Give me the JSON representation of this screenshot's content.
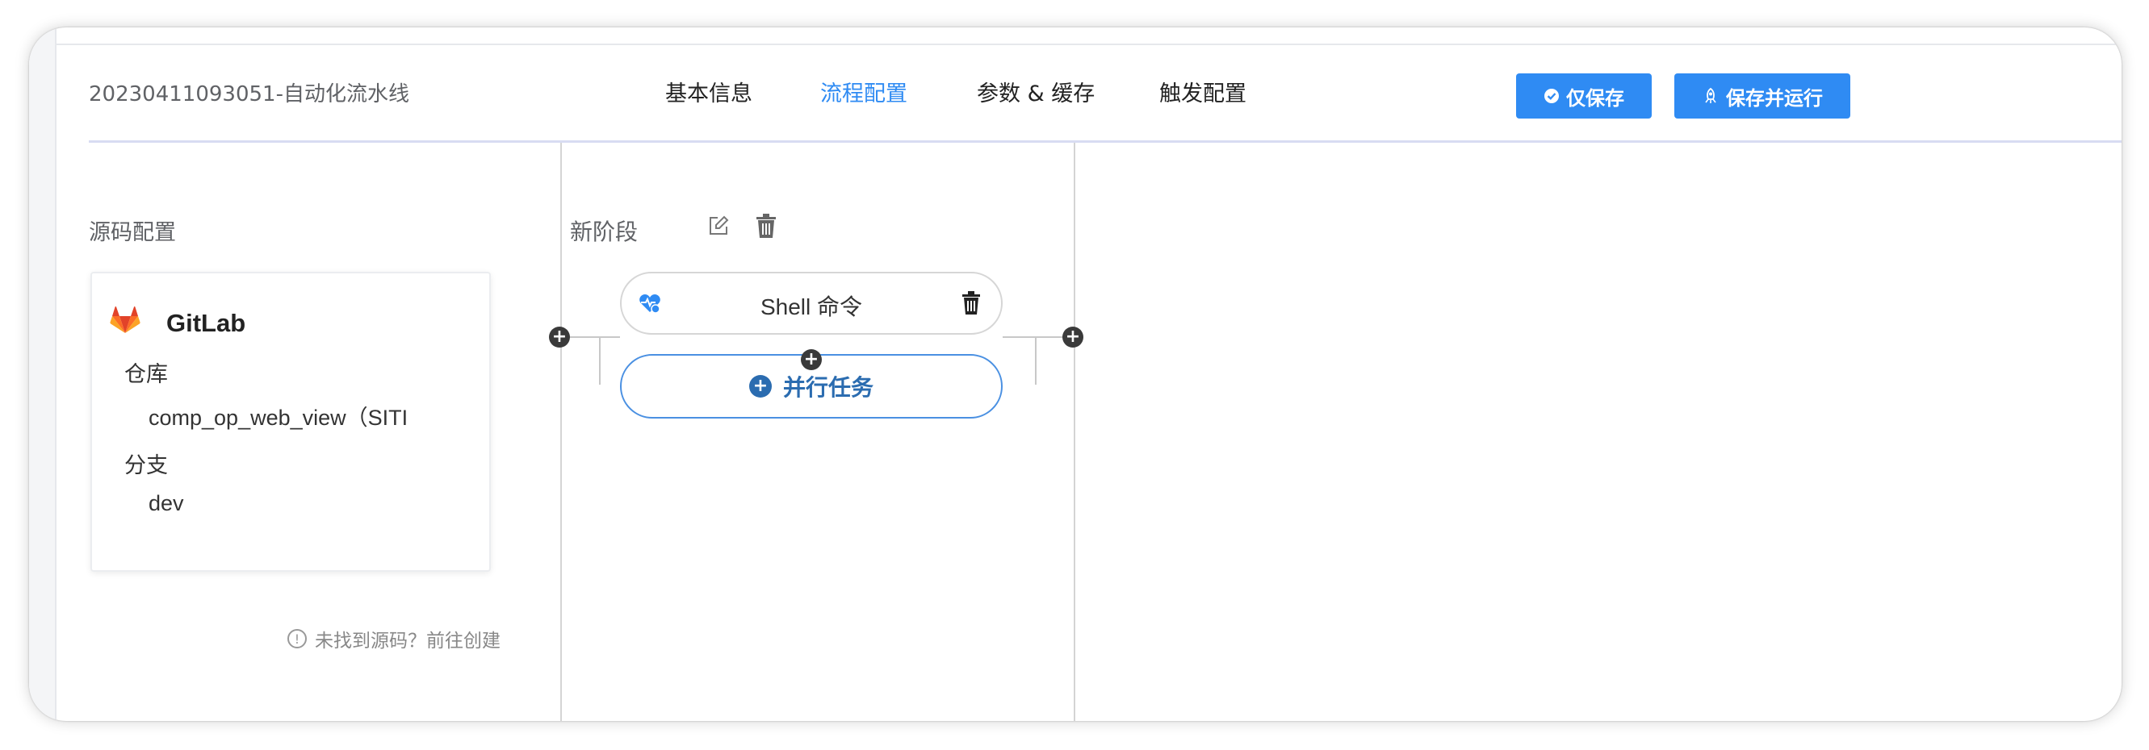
{
  "header": {
    "pipeline_title": "20230411093051-自动化流水线",
    "tabs": [
      {
        "label": "基本信息",
        "active": false
      },
      {
        "label": "流程配置",
        "active": true
      },
      {
        "label": "参数 & 缓存",
        "active": false
      },
      {
        "label": "触发配置",
        "active": false
      }
    ],
    "save_only_label": "仅保存",
    "save_and_run_label": "保存并运行"
  },
  "source": {
    "section_label": "源码配置",
    "provider": "GitLab",
    "repo_label": "仓库",
    "repo_value": "comp_op_web_view（SITI",
    "branch_label": "分支",
    "branch_value": "dev",
    "hint_text": "未找到源码？前往创建"
  },
  "stage": {
    "title": "新阶段",
    "task_label": "Shell 命令",
    "parallel_label": "并行任务"
  },
  "colors": {
    "accent": "#2f8bf3",
    "parallel_text": "#2b6cb0",
    "gitlab_orange": "#e24329"
  }
}
